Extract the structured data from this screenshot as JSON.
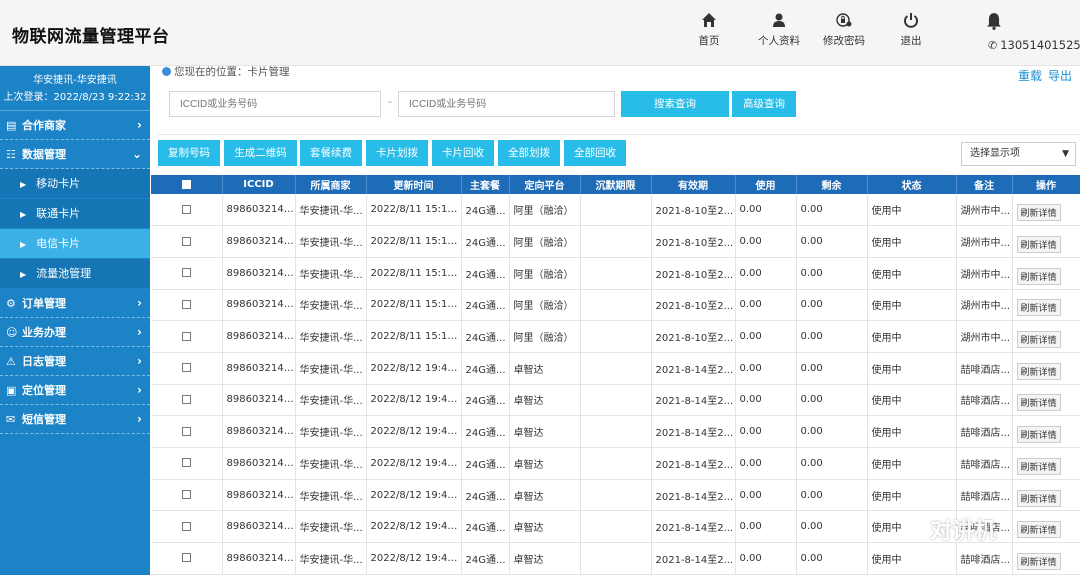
{
  "header": {
    "title": "物联网流量管理平台",
    "nav": [
      {
        "icon": "home-icon",
        "label": "首页"
      },
      {
        "icon": "user-icon",
        "label": "个人资料"
      },
      {
        "icon": "lock-icon",
        "label": "修改密码"
      },
      {
        "icon": "power-icon",
        "label": "退出"
      }
    ],
    "phone": "13051401525"
  },
  "sidebar": {
    "user": "华安捷讯-华安捷讯",
    "last_login": "上次登录：2022/8/23 9:22:32",
    "menus": [
      {
        "label": "合作商家",
        "icon": "chart-icon",
        "arrow": "›"
      },
      {
        "label": "数据管理",
        "icon": "data-icon",
        "arrow": "⌄"
      },
      {
        "label": "订单管理",
        "icon": "gear-icon",
        "arrow": "›"
      },
      {
        "label": "业务办理",
        "icon": "person-icon",
        "arrow": "›"
      },
      {
        "label": "日志管理",
        "icon": "warning-icon",
        "arrow": "›"
      },
      {
        "label": "定位管理",
        "icon": "location-icon",
        "arrow": "›"
      },
      {
        "label": "短信管理",
        "icon": "message-icon",
        "arrow": "›"
      }
    ],
    "submenu": [
      "移动卡片",
      "联通卡片",
      "电信卡片",
      "流量池管理"
    ]
  },
  "breadcrumb": "您现在的位置：卡片管理",
  "toplinks": {
    "reload": "重载",
    "export": "导出"
  },
  "search": {
    "placeholder": "ICCID或业务号码",
    "sep": "-",
    "search_btn": "搜索查询",
    "advanced_btn": "高级查询"
  },
  "toolbar": [
    "复制号码",
    "生成二维码",
    "套餐续费",
    "卡片划拨",
    "卡片回收",
    "全部划拨",
    "全部回收"
  ],
  "column_select": "选择显示项",
  "table": {
    "columns": [
      "",
      "ICCID",
      "所属商家",
      "更新时间",
      "主套餐",
      "定向平台",
      "沉默期限",
      "有效期",
      "使用",
      "剩余",
      "状态",
      "备注",
      "操作"
    ],
    "rows": [
      [
        "8986032140...",
        "华安捷讯-华...",
        "2022/8/11 15:15:...",
        "24G通...",
        "阿里（融洽）",
        "",
        "2021-8-10至2...",
        "0.00",
        "0.00",
        "使用中",
        "湖州市中...",
        "刷新详情"
      ],
      [
        "8986032140...",
        "华安捷讯-华...",
        "2022/8/11 15:15:...",
        "24G通...",
        "阿里（融洽）",
        "",
        "2021-8-10至2...",
        "0.00",
        "0.00",
        "使用中",
        "湖州市中...",
        "刷新详情"
      ],
      [
        "8986032140...",
        "华安捷讯-华...",
        "2022/8/11 15:16:...",
        "24G通...",
        "阿里（融洽）",
        "",
        "2021-8-10至2...",
        "0.00",
        "0.00",
        "使用中",
        "湖州市中...",
        "刷新详情"
      ],
      [
        "8986032140...",
        "华安捷讯-华...",
        "2022/8/11 15:17:...",
        "24G通...",
        "阿里（融洽）",
        "",
        "2021-8-10至2...",
        "0.00",
        "0.00",
        "使用中",
        "湖州市中...",
        "刷新详情"
      ],
      [
        "8986032140...",
        "华安捷讯-华...",
        "2022/8/11 15:15:...",
        "24G通...",
        "阿里（融洽）",
        "",
        "2021-8-10至2...",
        "0.00",
        "0.00",
        "使用中",
        "湖州市中...",
        "刷新详情"
      ],
      [
        "8986032140...",
        "华安捷讯-华...",
        "2022/8/12 19:46:...",
        "24G通...",
        "卓智达",
        "",
        "2021-8-14至2...",
        "0.00",
        "0.00",
        "使用中",
        "喆啡酒店...",
        "刷新详情"
      ],
      [
        "8986032140...",
        "华安捷讯-华...",
        "2022/8/12 19:45:...",
        "24G通...",
        "卓智达",
        "",
        "2021-8-14至2...",
        "0.00",
        "0.00",
        "使用中",
        "喆啡酒店...",
        "刷新详情"
      ],
      [
        "8986032140...",
        "华安捷讯-华...",
        "2022/8/12 19:46:...",
        "24G通...",
        "卓智达",
        "",
        "2021-8-14至2...",
        "0.00",
        "0.00",
        "使用中",
        "喆啡酒店...",
        "刷新详情"
      ],
      [
        "8986032140...",
        "华安捷讯-华...",
        "2022/8/12 19:46:...",
        "24G通...",
        "卓智达",
        "",
        "2021-8-14至2...",
        "0.00",
        "0.00",
        "使用中",
        "喆啡酒店...",
        "刷新详情"
      ],
      [
        "8986032140...",
        "华安捷讯-华...",
        "2022/8/12 19:45:...",
        "24G通...",
        "卓智达",
        "",
        "2021-8-14至2...",
        "0.00",
        "0.00",
        "使用中",
        "喆啡酒店...",
        "刷新详情"
      ],
      [
        "8986032140...",
        "华安捷讯-华...",
        "2022/8/12 19:46:...",
        "24G通...",
        "卓智达",
        "",
        "2021-8-14至2...",
        "0.00",
        "0.00",
        "使用中",
        "喆啡酒店...",
        "刷新详情"
      ],
      [
        "8986032140...",
        "华安捷讯-华...",
        "2022/8/12 19:46:...",
        "24G通...",
        "卓智达",
        "",
        "2021-8-14至2...",
        "0.00",
        "0.00",
        "使用中",
        "喆啡酒店...",
        "刷新详情"
      ]
    ]
  },
  "watermark": "对讲机"
}
